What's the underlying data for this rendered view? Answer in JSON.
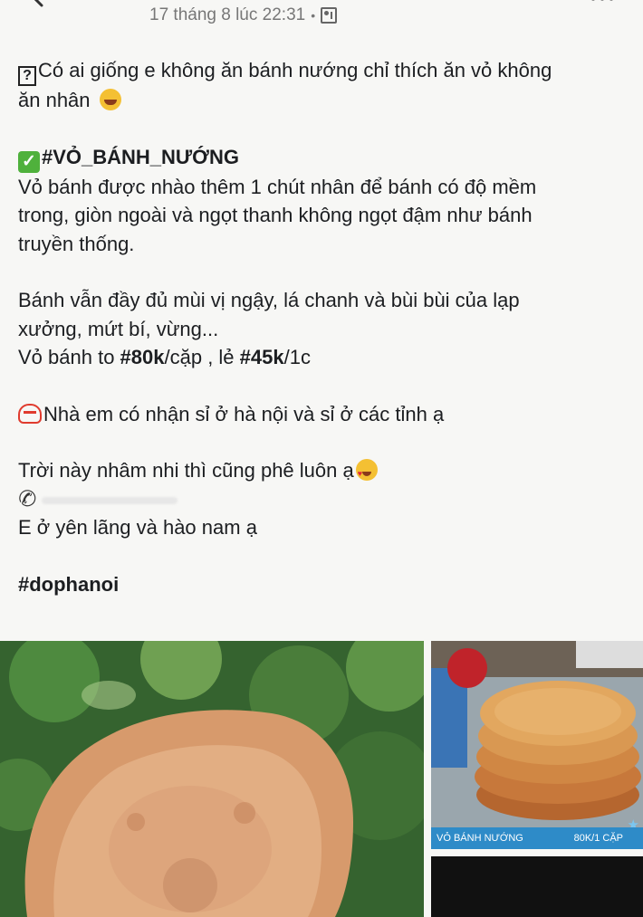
{
  "header": {
    "timestamp": "17 tháng 8 lúc 22:31",
    "separator": "•"
  },
  "post": {
    "intro_line1": "Có ai giống e không ăn bánh nướng chỉ thích ăn vỏ không",
    "intro_line2": "ăn nhân",
    "hashtag_title": "#VỎ_BÁNH_NƯỚNG",
    "desc_line1": "Vỏ bánh được nhào thêm 1 chút nhân để bánh có độ mềm",
    "desc_line2": "trong, giòn ngoài và ngọt thanh không ngọt đậm như bánh",
    "desc_line3": "truyền thống.",
    "flavor_line1": "Bánh vẫn đầy đủ mùi vị ngậy, lá chanh và bùi bùi của lạp",
    "flavor_line2": "xưởng, mứt bí, vừng...",
    "price_prefix": "Vỏ bánh to ",
    "price_pair": "#80k",
    "price_pair_unit": "/cặp , lẻ ",
    "price_single": "#45k",
    "price_single_unit": "/1c",
    "wholesale": "Nhà em có nhận sỉ ở hà nội và sỉ ở các tỉnh ạ",
    "weather": "Trời này nhâm nhi thì cũng phê luôn ạ",
    "location": "E ở yên lãng và hào nam ạ",
    "hashtag_footer": "#dophanoi"
  },
  "images": {
    "caption_left": "VỎ BÁNH NƯỚNG",
    "caption_right": "80K/1 CẶP",
    "stamp_text": "Đỗ Phố"
  },
  "icons": [
    "back-arrow-icon",
    "privacy-icon",
    "more-icon",
    "question-box-icon",
    "laughing-emoji-icon",
    "check-mark-icon",
    "hundred-icon",
    "heart-eyes-emoji-icon",
    "phone-icon",
    "star-icon"
  ]
}
